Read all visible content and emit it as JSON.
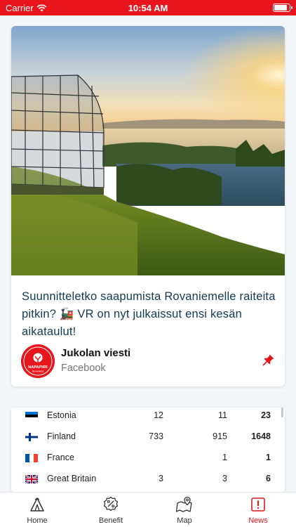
{
  "status_bar": {
    "carrier": "Carrier",
    "time": "10:54 AM",
    "battery_level": 0.9
  },
  "news_card": {
    "headline": "Suunnitteletko saapumista Rovaniemelle raiteita pitkin? 🚂 VR on nyt julkaissut ensi kesän aikataulut!",
    "source_name": "Jukolan viesti",
    "source_platform": "Facebook",
    "logo_text": "NAPAPIIRI",
    "logo_subtext": "Rovaniemi",
    "image_icon": "arktikum-landscape-photo",
    "pin_icon": "pin-icon"
  },
  "table": {
    "rows": [
      {
        "country": "Estonia",
        "c1": "12",
        "c2": "11",
        "c3": "23",
        "flag": "estonia-flag-icon"
      },
      {
        "country": "Finland",
        "c1": "733",
        "c2": "915",
        "c3": "1648",
        "flag": "finland-flag-icon"
      },
      {
        "country": "France",
        "c1": "",
        "c2": "1",
        "c3": "1",
        "flag": "france-flag-icon"
      },
      {
        "country": "Great Britain",
        "c1": "3",
        "c2": "3",
        "c3": "6",
        "flag": "great-britain-flag-icon"
      }
    ]
  },
  "tabbar": {
    "tabs": [
      {
        "label": "Home",
        "icon": "tent-icon"
      },
      {
        "label": "Benefit",
        "icon": "percent-badge-icon"
      },
      {
        "label": "Map",
        "icon": "map-pin-icon"
      },
      {
        "label": "News",
        "icon": "alert-icon",
        "active": true
      }
    ]
  },
  "colors": {
    "accent": "#e8161c",
    "headline": "#133a54",
    "background": "#f3f6f9"
  }
}
